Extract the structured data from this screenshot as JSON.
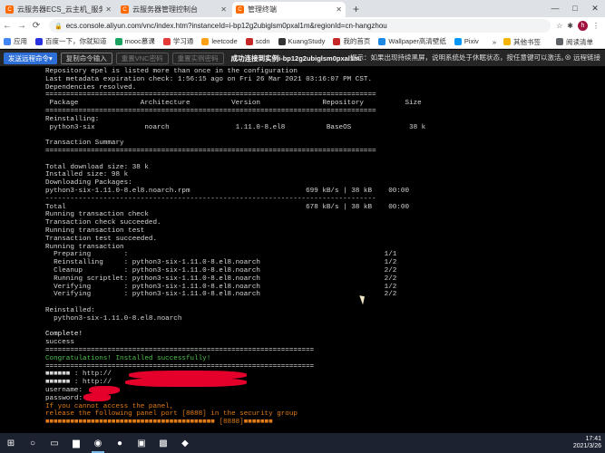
{
  "browser": {
    "tabs": [
      {
        "favicon": "C",
        "title": "云服务器ECS_云主机_服务器托管"
      },
      {
        "favicon": "C",
        "title": "云服务器管理控制台"
      },
      {
        "favicon": "C",
        "title": "管理终端"
      }
    ],
    "new_tab_label": "+",
    "window_controls": [
      "—",
      "□",
      "✕"
    ],
    "url": "ecs.console.aliyun.com/vnc/index.htm?instanceId=i-bp12g2ubiglsm0pxal1m&regionId=cn-hangzhou",
    "nav_back": "←",
    "nav_forward": "→",
    "nav_reload": "⟳",
    "avatar_letter": "h"
  },
  "bookmarks": {
    "items": [
      {
        "label": "应用",
        "color": "#4285f4"
      },
      {
        "label": "百度一下，你就知道",
        "color": "#2932e1"
      },
      {
        "label": "mooc慕课",
        "color": "#1aa260"
      },
      {
        "label": "学习通",
        "color": "#e53935"
      },
      {
        "label": "leetcode",
        "color": "#ffa116"
      },
      {
        "label": "scdn",
        "color": "#c62828"
      },
      {
        "label": "KuangStudy",
        "color": "#333333"
      },
      {
        "label": "我的首页",
        "color": "#c62828"
      },
      {
        "label": "Wallpaper高清壁纸",
        "color": "#1e88e5"
      },
      {
        "label": "Pixiv",
        "color": "#0096fa"
      }
    ],
    "other": "其他书签",
    "reading_list": "阅读清单"
  },
  "vnc_toolbar": {
    "send_keys": "发送远程命令▾",
    "copy_paste": "复制命令输入",
    "reset_pwd": "重置VNC密码",
    "reset_instance": "重置实例密码",
    "status": "成功连接到实例i-bp12g2ubiglsm0pxal1m.",
    "hint": "提示：如果出现持续黑屏，说明系统处于休眠状态，按任意键可以激活。",
    "close": "⊗ 远程链接",
    "accent": "#2d6fd6"
  },
  "terminal": {
    "lines": [
      "Repository epel is listed more than once in the configuration",
      "Last metadata expiration check: 1:56:15 ago on Fri 26 Mar 2021 03:16:07 PM CST.",
      "Dependencies resolved.",
      "================================================================================",
      " Package               Architecture          Version               Repository          Size",
      "================================================================================",
      "Reinstalling:",
      " python3-six            noarch                1.11.0-8.el8          BaseOS              38 k",
      "",
      "Transaction Summary",
      "================================================================================",
      "",
      "Total download size: 38 k",
      "Installed size: 98 k",
      "Downloading Packages:",
      "python3-six-1.11.0-8.el8.noarch.rpm                            699 kB/s | 38 kB    00:00",
      "--------------------------------------------------------------------------------",
      "Total                                                          678 kB/s | 38 kB    00:00",
      "Running transaction check",
      "Transaction check succeeded.",
      "Running transaction test",
      "Transaction test succeeded.",
      "Running transaction",
      "  Preparing        :                                                              1/1",
      "  Reinstalling     : python3-six-1.11.0-8.el8.noarch                              1/2",
      "  Cleanup          : python3-six-1.11.0-8.el8.noarch                              2/2",
      "  Running scriptlet: python3-six-1.11.0-8.el8.noarch                              2/2",
      "  Verifying        : python3-six-1.11.0-8.el8.noarch                              1/2",
      "  Verifying        : python3-six-1.11.0-8.el8.noarch                              2/2",
      "",
      "Reinstalled:",
      "  python3-six-1.11.0-8.el8.noarch",
      "",
      "Complete!",
      "success",
      "=================================================================",
      "Congratulations! Installed successfully!",
      "=================================================================",
      "■■■■■■ : http://",
      "■■■■■■ : http://",
      "username: ",
      "password: ",
      "If you cannot access the panel,",
      "release the following panel port [8888] in the security group",
      "■■■■■■■■■■■■■■■■■■■■■■■■■■■■■■■■■■■■■■■■■ [8888]■■■■■■■"
    ],
    "green_lines": [
      36
    ],
    "orange_lines": [
      42,
      43,
      44
    ],
    "white_lines": [
      33
    ]
  },
  "taskbar": {
    "items": [
      {
        "icon": "windows-icon",
        "glyph": "⊞"
      },
      {
        "icon": "search-icon",
        "glyph": "○"
      },
      {
        "icon": "task-view-icon",
        "glyph": "▭"
      },
      {
        "icon": "file-explorer-icon",
        "glyph": "▆"
      },
      {
        "icon": "chrome-icon",
        "glyph": "◉"
      },
      {
        "icon": "firefox-icon",
        "glyph": "●"
      },
      {
        "icon": "terminal-icon",
        "glyph": "▣"
      },
      {
        "icon": "jetbrains-icon",
        "glyph": "▩"
      },
      {
        "icon": "vscode-icon",
        "glyph": "◆"
      }
    ],
    "time": "17:41",
    "date": "2021/3/26"
  }
}
